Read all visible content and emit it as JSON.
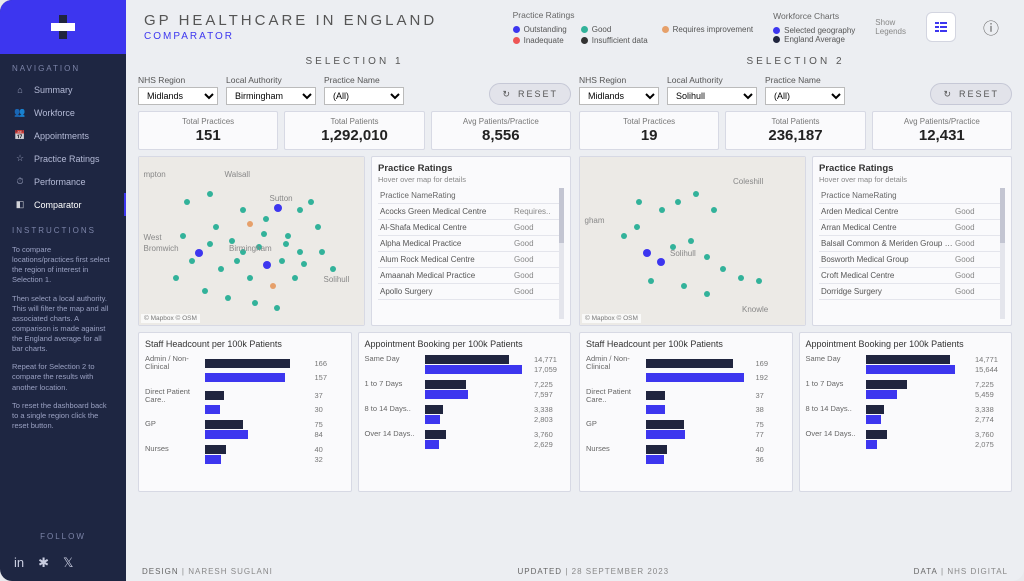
{
  "header": {
    "title": "GP HEALTHCARE IN ENGLAND",
    "subtitle": "COMPARATOR"
  },
  "legends": {
    "ratings": {
      "title": "Practice Ratings",
      "items": [
        {
          "label": "Outstanding",
          "color": "#3d36ef"
        },
        {
          "label": "Good",
          "color": "#32b29a"
        },
        {
          "label": "Requires improvement",
          "color": "#e6a06a"
        },
        {
          "label": "Inadequate",
          "color": "#e55"
        },
        {
          "label": "Insufficient data",
          "color": "#333"
        }
      ]
    },
    "workforce": {
      "title": "Workforce Charts",
      "items": [
        {
          "label": "Selected geography",
          "color": "#3d36ef"
        },
        {
          "label": "England Average",
          "color": "#20253f"
        }
      ]
    },
    "show_legends": "Show\nLegends"
  },
  "sidebar": {
    "nav_title": "NAVIGATION",
    "items": [
      {
        "icon": "home",
        "label": "Summary"
      },
      {
        "icon": "users",
        "label": "Workforce"
      },
      {
        "icon": "calendar",
        "label": "Appointments"
      },
      {
        "icon": "star",
        "label": "Practice Ratings"
      },
      {
        "icon": "gauge",
        "label": "Performance"
      },
      {
        "icon": "compare",
        "label": "Comparator",
        "active": true
      }
    ],
    "instructions_title": "INSTRUCTIONS",
    "instructions": [
      "To compare locations/practices first select the region of interest in Selection 1.",
      "Then select a local authority. This will filter the map and all associated charts. A comparison is made against the England average for all bar charts.",
      "Repeat for Selection 2 to compare the results with another location.",
      "To reset the dashboard back to a single region click the reset button."
    ],
    "follow_title": "FOLLOW"
  },
  "selection1": {
    "heading": "SELECTION 1",
    "filters": {
      "region_label": "NHS Region",
      "region": "Midlands",
      "la_label": "Local Authority",
      "la": "Birmingham",
      "pn_label": "Practice Name",
      "pn": "(All)"
    },
    "reset": "RESET",
    "stats": [
      {
        "label": "Total Practices",
        "value": "151"
      },
      {
        "label": "Total Patients",
        "value": "1,292,010"
      },
      {
        "label": "Avg Patients/Practice",
        "value": "8,556"
      }
    ],
    "map": {
      "attr": "© Mapbox  © OSM",
      "places": [
        "mpton",
        "Walsall",
        "West Bromwich",
        "Birmingham",
        "Solihull",
        "Sutton"
      ]
    },
    "ratings": {
      "title": "Practice Ratings",
      "hint": "Hover over map for details",
      "head_name": "Practice Name",
      "head_rating": "Rating",
      "rows": [
        {
          "name": "Acocks Green Medical Centre",
          "rating": "Requires.."
        },
        {
          "name": "Al-Shafa Medical Centre",
          "rating": "Good"
        },
        {
          "name": "Alpha Medical Practice",
          "rating": "Good"
        },
        {
          "name": "Alum Rock Medical Centre",
          "rating": "Good"
        },
        {
          "name": "Amaanah Medical Practice",
          "rating": "Good"
        },
        {
          "name": "Apollo Surgery",
          "rating": "Good"
        }
      ]
    }
  },
  "selection2": {
    "heading": "SELECTION 2",
    "filters": {
      "region_label": "NHS Region",
      "region": "Midlands",
      "la_label": "Local Authority",
      "la": "Solihull",
      "pn_label": "Practice Name",
      "pn": "(All)"
    },
    "reset": "RESET",
    "stats": [
      {
        "label": "Total Practices",
        "value": "19"
      },
      {
        "label": "Total Patients",
        "value": "236,187"
      },
      {
        "label": "Avg Patients/Practice",
        "value": "12,431"
      }
    ],
    "map": {
      "attr": "© Mapbox  © OSM",
      "places": [
        "gham",
        "Solihull",
        "Coleshill",
        "Knowle"
      ]
    },
    "ratings": {
      "title": "Practice Ratings",
      "hint": "Hover over map for details",
      "head_name": "Practice Name",
      "head_rating": "Rating",
      "rows": [
        {
          "name": "Arden Medical Centre",
          "rating": "Good"
        },
        {
          "name": "Arran Medical Centre",
          "rating": "Good"
        },
        {
          "name": "Balsall Common & Meriden Group Pr..",
          "rating": "Good"
        },
        {
          "name": "Bosworth Medical Group",
          "rating": "Good"
        },
        {
          "name": "Croft Medical Centre",
          "rating": "Good"
        },
        {
          "name": "Dorridge Surgery",
          "rating": "Good"
        }
      ]
    }
  },
  "chart_data": [
    {
      "type": "bar",
      "title": "Staff Headcount per 100k Patients",
      "owner": "selection1",
      "categories": [
        "Admin / Non-Clinical",
        "Direct Patient Care..",
        "GP",
        "Nurses"
      ],
      "series": [
        {
          "name": "Selected geography",
          "values": [
            166,
            37,
            75,
            40
          ]
        },
        {
          "name": "England Average",
          "values": [
            157,
            30,
            84,
            32
          ]
        }
      ],
      "xlim": [
        0,
        200
      ]
    },
    {
      "type": "bar",
      "title": "Appointment Booking per 100k Patients",
      "owner": "selection1",
      "categories": [
        "Same Day",
        "1 to 7 Days",
        "8 to 14 Days..",
        "Over 14 Days.."
      ],
      "series": [
        {
          "name": "Selected geography",
          "values": [
            14771,
            7225,
            3338,
            3760
          ]
        },
        {
          "name": "England Average",
          "values": [
            17059,
            7597,
            2803,
            2629
          ]
        }
      ],
      "xlim": [
        0,
        18000
      ]
    },
    {
      "type": "bar",
      "title": "Staff Headcount per 100k Patients",
      "owner": "selection2",
      "categories": [
        "Admin / Non-Clinical",
        "Direct Patient Care..",
        "GP",
        "Nurses"
      ],
      "series": [
        {
          "name": "Selected geography",
          "values": [
            169,
            37,
            75,
            40
          ]
        },
        {
          "name": "England Average",
          "values": [
            192,
            38,
            77,
            36
          ]
        }
      ],
      "xlim": [
        0,
        200
      ]
    },
    {
      "type": "bar",
      "title": "Appointment Booking per 100k Patients",
      "owner": "selection2",
      "categories": [
        "Same Day",
        "1 to 7 Days",
        "8 to 14 Days..",
        "Over 14 Days.."
      ],
      "series": [
        {
          "name": "Selected geography",
          "values": [
            14771,
            7225,
            3338,
            3760
          ]
        },
        {
          "name": "England Average",
          "values": [
            15644,
            5459,
            2774,
            2075
          ]
        }
      ],
      "xlim": [
        0,
        18000
      ]
    }
  ],
  "footer": {
    "design_label": "DESIGN",
    "design": "NARESH SUGLANI",
    "updated_label": "UPDATED",
    "updated": "28 SEPTEMBER 2023",
    "data_label": "DATA",
    "data": "NHS DIGITAL"
  }
}
